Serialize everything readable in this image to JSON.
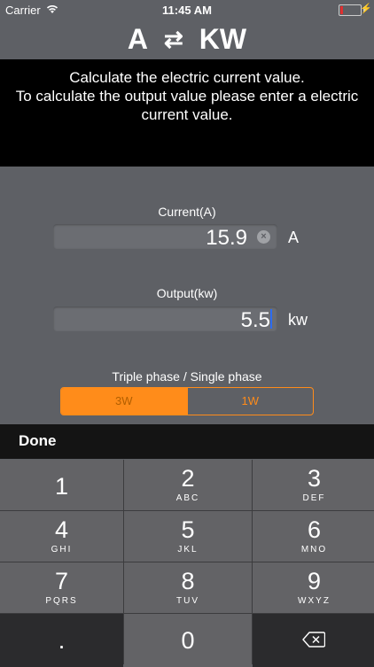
{
  "status": {
    "carrier": "Carrier",
    "time": "11:45 AM"
  },
  "header": {
    "left": "A",
    "swap_symbol": "⇄",
    "right": "KW"
  },
  "info": {
    "line1": "Calculate the electric current value.",
    "line2": "To calculate the output value please enter a electric",
    "line3": "current value."
  },
  "current": {
    "label": "Current(A)",
    "value": "15.9",
    "unit": "A"
  },
  "output": {
    "label": "Output(kw)",
    "value": "5.5",
    "unit": "kw"
  },
  "phase": {
    "label": "Triple phase / Single phase",
    "options": [
      "3W",
      "1W"
    ],
    "selected": "3W"
  },
  "toolbar": {
    "done": "Done"
  },
  "keypad": {
    "keys": [
      {
        "digit": "1",
        "letters": ""
      },
      {
        "digit": "2",
        "letters": "ABC"
      },
      {
        "digit": "3",
        "letters": "DEF"
      },
      {
        "digit": "4",
        "letters": "GHI"
      },
      {
        "digit": "5",
        "letters": "JKL"
      },
      {
        "digit": "6",
        "letters": "MNO"
      },
      {
        "digit": "7",
        "letters": "PQRS"
      },
      {
        "digit": "8",
        "letters": "TUV"
      },
      {
        "digit": "9",
        "letters": "WXYZ"
      }
    ],
    "dot": ".",
    "zero": "0"
  },
  "colors": {
    "accent": "#ff8c1a",
    "background": "#5e6065",
    "cursor": "#2d6cf0"
  }
}
